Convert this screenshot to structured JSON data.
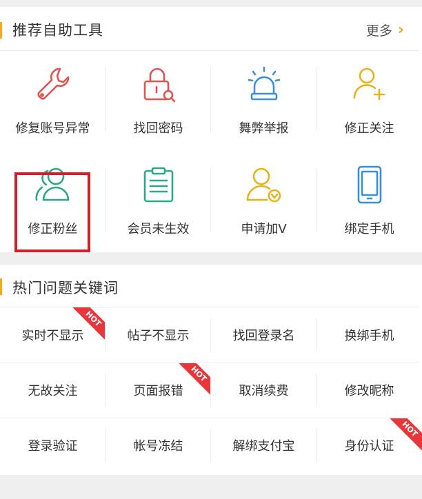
{
  "tools_section": {
    "title": "推荐自助工具",
    "more_label": "更多",
    "items": [
      {
        "label": "修复账号异常",
        "icon": "wrench-icon"
      },
      {
        "label": "找回密码",
        "icon": "lock-icon"
      },
      {
        "label": "舞弊举报",
        "icon": "alarm-siren-icon"
      },
      {
        "label": "修正关注",
        "icon": "user-plus-icon"
      },
      {
        "label": "修正粉丝",
        "icon": "users-icon"
      },
      {
        "label": "会员未生效",
        "icon": "clipboard-icon"
      },
      {
        "label": "申请加V",
        "icon": "user-verified-icon"
      },
      {
        "label": "绑定手机",
        "icon": "phone-icon"
      }
    ]
  },
  "hot_section": {
    "title": "热门问题关键词",
    "hot_badge": "HOT",
    "keywords": [
      {
        "label": "实时不显示",
        "hot": true
      },
      {
        "label": "帖子不显示",
        "hot": false
      },
      {
        "label": "找回登录名",
        "hot": false
      },
      {
        "label": "换绑手机",
        "hot": false
      },
      {
        "label": "无故关注",
        "hot": false
      },
      {
        "label": "页面报错",
        "hot": true
      },
      {
        "label": "取消续费",
        "hot": false
      },
      {
        "label": "修改昵称",
        "hot": false
      },
      {
        "label": "登录验证",
        "hot": false
      },
      {
        "label": "帐号冻结",
        "hot": false
      },
      {
        "label": "解绑支付宝",
        "hot": false
      },
      {
        "label": "身份认证",
        "hot": true
      }
    ]
  },
  "colors": {
    "accent": "#f5a623",
    "red": "#e0534f",
    "green": "#2aa88a",
    "blue": "#3a8fd8",
    "yellow": "#e8b21c",
    "highlight": "#d0202a",
    "hot": "#e8373b"
  }
}
